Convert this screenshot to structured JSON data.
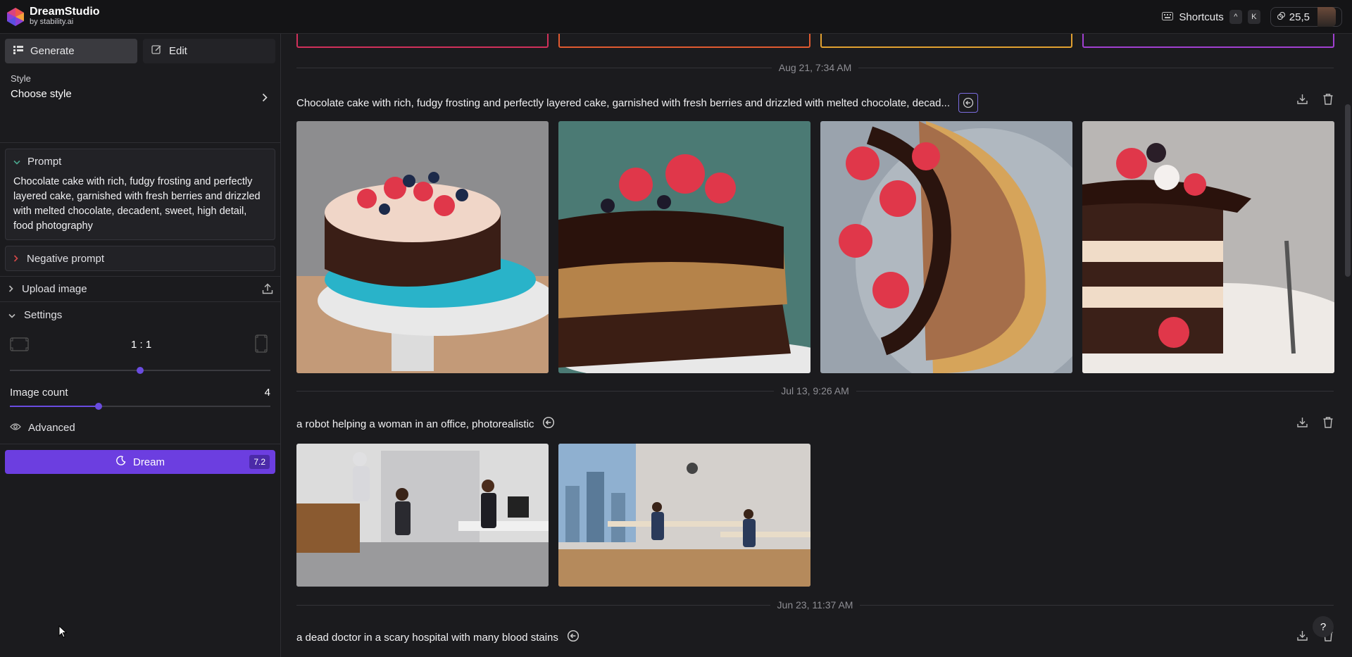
{
  "app": {
    "title": "DreamStudio",
    "subtitle": "by stability.ai"
  },
  "topbar": {
    "shortcuts_label": "Shortcuts",
    "key1": "^",
    "key2": "K",
    "credits": "25,5"
  },
  "sidebar": {
    "tabs": [
      {
        "label": "Generate"
      },
      {
        "label": "Edit"
      }
    ],
    "style": {
      "label": "Style",
      "value": "Choose style"
    },
    "prompt": {
      "header": "Prompt",
      "text": "Chocolate cake with rich, fudgy frosting and perfectly layered cake, garnished with fresh berries and drizzled with melted chocolate, decadent, sweet, high detail, food photography"
    },
    "negative_prompt": {
      "header": "Negative prompt"
    },
    "upload": {
      "label": "Upload image"
    },
    "settings": {
      "label": "Settings",
      "aspect_ratio": "1 : 1",
      "aspect_slider_fraction": 0.5,
      "image_count_label": "Image count",
      "image_count": "4",
      "image_count_fraction": 0.34
    },
    "advanced": {
      "label": "Advanced"
    },
    "dream": {
      "label": "Dream",
      "cost": "7.2"
    }
  },
  "feed": [
    {
      "date": "Aug 21, 7:34 AM",
      "prompt": "Chocolate cake with rich, fudgy frosting and perfectly layered cake, garnished with fresh berries and drizzled with melted chocolate, decad...",
      "images": 4
    },
    {
      "date": "Jul 13, 9:26 AM",
      "prompt": "a robot helping a woman in an office, photorealistic",
      "images": 2
    },
    {
      "date": "Jun 23, 11:37 AM",
      "prompt": "a dead doctor in a scary hospital with many blood stains",
      "images": 0
    }
  ],
  "help": {
    "label": "?"
  },
  "colors": {
    "accent": "#6c3ee0",
    "background": "#1b1b1e",
    "topbar": "#141416"
  }
}
